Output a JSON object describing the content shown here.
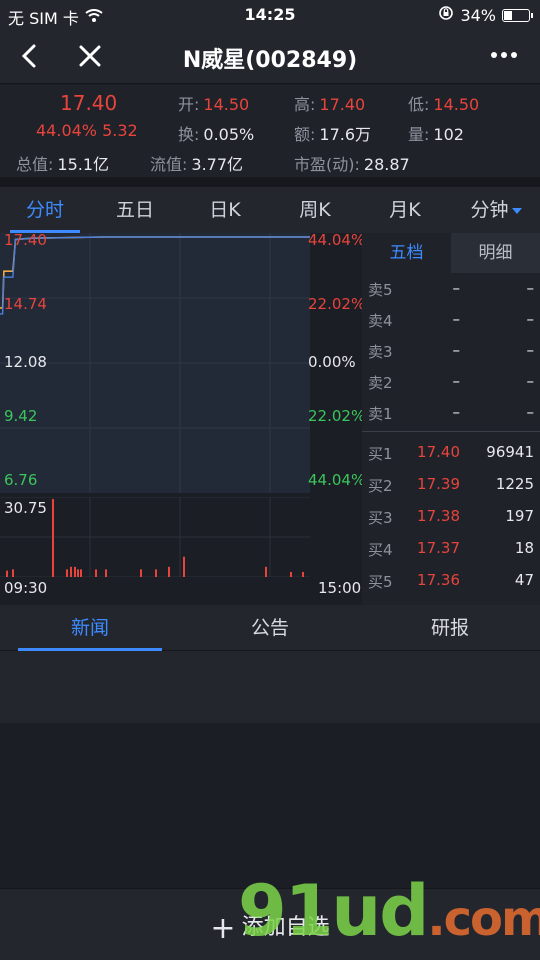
{
  "status_bar": {
    "carrier": "无 SIM 卡",
    "time": "14:25",
    "battery": "34%",
    "battery_level": 0.34
  },
  "nav": {
    "title": "N威星(002849)"
  },
  "quote": {
    "price": "17.40",
    "change": "44.04% 5.32",
    "rows": [
      {
        "k": "开:",
        "v": "14.50",
        "red": true
      },
      {
        "k": "高:",
        "v": "17.40",
        "red": true
      },
      {
        "k": "低:",
        "v": "14.50",
        "red": true
      },
      {
        "k": "换:",
        "v": "0.05%",
        "red": false
      },
      {
        "k": "额:",
        "v": "17.6万",
        "red": false
      },
      {
        "k": "量:",
        "v": "102",
        "red": false
      },
      {
        "k": "总值:",
        "v": "15.1亿",
        "red": false
      },
      {
        "k": "流值:",
        "v": "3.77亿",
        "red": false
      },
      {
        "k": "市盈(动):",
        "v": "28.87",
        "red": false
      }
    ]
  },
  "tabs": [
    "分时",
    "五日",
    "日K",
    "周K",
    "月K",
    "分钟"
  ],
  "chart": {
    "y_left": [
      "17.40",
      "14.74",
      "12.08",
      "9.42",
      "6.76"
    ],
    "y_right": [
      "44.04%",
      "22.02%",
      "0.00%",
      "22.02%",
      "44.04%"
    ],
    "volume_max": "30.75",
    "time_start": "09:30",
    "time_end": "15:00"
  },
  "chart_data": {
    "type": "line",
    "price_ylim": [
      6.76,
      17.4
    ],
    "price_points": [
      {
        "t": 0,
        "p": 14.5
      },
      {
        "t": 2,
        "p": 14.5
      },
      {
        "t": 3,
        "p": 16.0
      },
      {
        "t": 10,
        "p": 16.0
      },
      {
        "t": 12,
        "p": 17.3
      },
      {
        "t": 25,
        "p": 17.35
      },
      {
        "t": 80,
        "p": 17.4
      },
      {
        "t": 240,
        "p": 17.4
      }
    ],
    "volume_max": 30.75,
    "volume_bars": [
      {
        "t": 6,
        "v": 2.5
      },
      {
        "t": 12,
        "v": 3
      },
      {
        "t": 52,
        "v": 30.75
      },
      {
        "t": 66,
        "v": 3
      },
      {
        "t": 70,
        "v": 4
      },
      {
        "t": 74,
        "v": 4
      },
      {
        "t": 77,
        "v": 3
      },
      {
        "t": 80,
        "v": 3
      },
      {
        "t": 95,
        "v": 3
      },
      {
        "t": 105,
        "v": 3
      },
      {
        "t": 140,
        "v": 3
      },
      {
        "t": 155,
        "v": 3
      },
      {
        "t": 168,
        "v": 4
      },
      {
        "t": 183,
        "v": 8
      },
      {
        "t": 265,
        "v": 4
      },
      {
        "t": 290,
        "v": 2
      },
      {
        "t": 302,
        "v": 2
      }
    ]
  },
  "book": {
    "tabs": [
      "五档",
      "明细"
    ],
    "asks": [
      {
        "label": "卖5",
        "price": "–",
        "vol": "–"
      },
      {
        "label": "卖4",
        "price": "–",
        "vol": "–"
      },
      {
        "label": "卖3",
        "price": "–",
        "vol": "–"
      },
      {
        "label": "卖2",
        "price": "–",
        "vol": "–"
      },
      {
        "label": "卖1",
        "price": "–",
        "vol": "–"
      }
    ],
    "bids": [
      {
        "label": "买1",
        "price": "17.40",
        "vol": "96941"
      },
      {
        "label": "买2",
        "price": "17.39",
        "vol": "1225"
      },
      {
        "label": "买3",
        "price": "17.38",
        "vol": "197"
      },
      {
        "label": "买4",
        "price": "17.37",
        "vol": "18"
      },
      {
        "label": "买5",
        "price": "17.36",
        "vol": "47"
      }
    ]
  },
  "news_tabs": [
    "新闻",
    "公告",
    "研报"
  ],
  "bottom": {
    "add_label": "添加自选"
  },
  "watermark": {
    "text": "91ud",
    "suffix": ".com"
  }
}
